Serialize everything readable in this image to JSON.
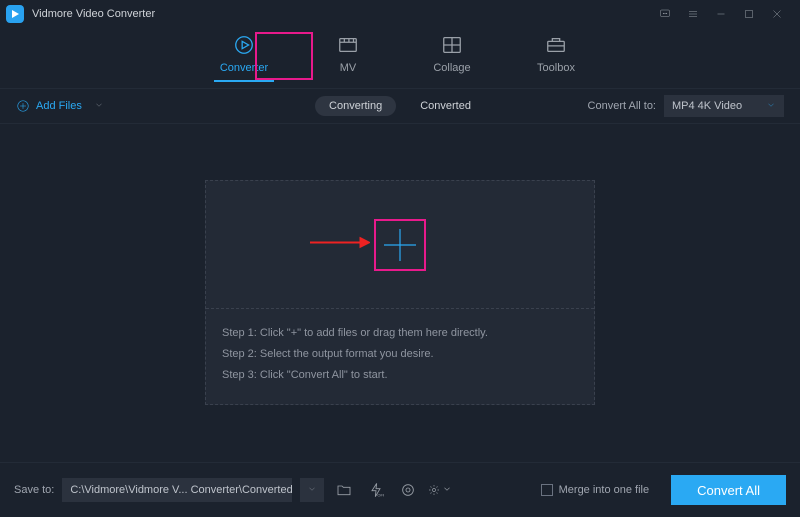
{
  "app": {
    "title": "Vidmore Video Converter"
  },
  "tabs": {
    "converter": "Converter",
    "mv": "MV",
    "collage": "Collage",
    "toolbox": "Toolbox"
  },
  "toolbar": {
    "add_files": "Add Files",
    "converting": "Converting",
    "converted": "Converted",
    "convert_all_to": "Convert All to:",
    "format_value": "MP4 4K Video"
  },
  "dropzone": {
    "step1": "Step 1: Click \"+\" to add files or drag them here directly.",
    "step2": "Step 2: Select the output format you desire.",
    "step3": "Step 3: Click \"Convert All\" to start."
  },
  "bottom": {
    "save_to_label": "Save to:",
    "save_path": "C:\\Vidmore\\Vidmore V... Converter\\Converted",
    "merge_label": "Merge into one file",
    "convert_all": "Convert All"
  }
}
